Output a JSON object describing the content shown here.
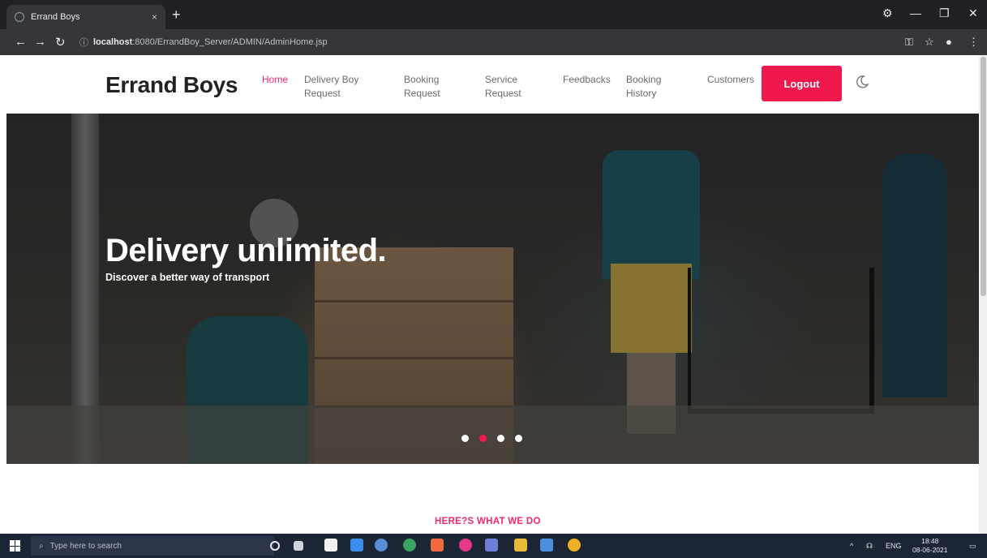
{
  "browser": {
    "tab_title": "Errand Boys",
    "tab_close": "×",
    "new_tab": "+",
    "url_host": "localhost",
    "url_path": ":8080/ErrandBoy_Server/ADMIN/AdminHome.jsp"
  },
  "site": {
    "brand": "Errand Boys",
    "nav": {
      "home": "Home",
      "delivery_boy_request": [
        "Delivery Boy",
        "Request"
      ],
      "booking_request": [
        "Booking",
        "Request"
      ],
      "service_request": [
        "Service",
        "Request"
      ],
      "feedbacks": "Feedbacks",
      "booking_history": [
        "Booking",
        "History"
      ],
      "customers": "Customers"
    },
    "logout_label": "Logout"
  },
  "hero": {
    "title": "Delivery unlimited.",
    "subtitle": "Discover a better way of transport",
    "slide_count": 4,
    "active_slide": 2
  },
  "section": {
    "label": "HERE?S WHAT WE DO"
  },
  "taskbar": {
    "search_placeholder": "Type here to search",
    "lang": "ENG",
    "time": "18:48",
    "date": "08-06-2021"
  },
  "colors": {
    "accent": "#f0194e",
    "nav_active": "#f0286e"
  },
  "icons": {
    "theme_toggle": "moon-icon",
    "start": "windows-icon",
    "search": "search-icon"
  }
}
